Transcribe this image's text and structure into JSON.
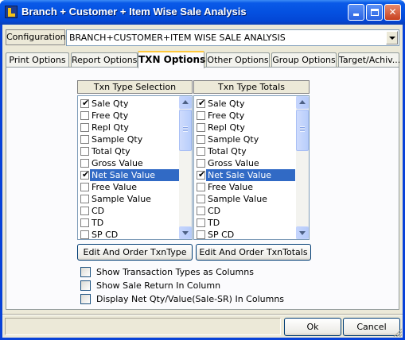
{
  "window": {
    "title": "Branch + Customer + Item Wise Sale Analysis"
  },
  "configuration": {
    "label": "Configuration",
    "value": "BRANCH+CUSTOMER+ITEM WISE SALE ANALYSIS"
  },
  "tabs": [
    {
      "label": "Print Options",
      "active": false
    },
    {
      "label": "Report Options",
      "active": false
    },
    {
      "label": "TXN Options",
      "active": true
    },
    {
      "label": "Other Options",
      "active": false
    },
    {
      "label": "Group Options",
      "active": false
    },
    {
      "label": "Target/Achiv...",
      "active": false
    }
  ],
  "txn_type_selection": {
    "header": "Txn Type Selection",
    "items": [
      {
        "label": "Sale Qty",
        "checked": true,
        "selected": false
      },
      {
        "label": "Free Qty",
        "checked": false,
        "selected": false
      },
      {
        "label": "Repl Qty",
        "checked": false,
        "selected": false
      },
      {
        "label": "Sample Qty",
        "checked": false,
        "selected": false
      },
      {
        "label": "Total Qty",
        "checked": false,
        "selected": false
      },
      {
        "label": "Gross Value",
        "checked": false,
        "selected": false
      },
      {
        "label": "Net Sale Value",
        "checked": true,
        "selected": true
      },
      {
        "label": "Free Value",
        "checked": false,
        "selected": false
      },
      {
        "label": "Sample Value",
        "checked": false,
        "selected": false
      },
      {
        "label": "CD",
        "checked": false,
        "selected": false
      },
      {
        "label": "TD",
        "checked": false,
        "selected": false
      },
      {
        "label": "SP CD",
        "checked": false,
        "selected": false
      }
    ],
    "button_label": "Edit And Order TxnType"
  },
  "txn_type_totals": {
    "header": "Txn Type Totals",
    "items": [
      {
        "label": "Sale Qty",
        "checked": true,
        "selected": false
      },
      {
        "label": "Free Qty",
        "checked": false,
        "selected": false
      },
      {
        "label": "Repl Qty",
        "checked": false,
        "selected": false
      },
      {
        "label": "Sample Qty",
        "checked": false,
        "selected": false
      },
      {
        "label": "Total Qty",
        "checked": false,
        "selected": false
      },
      {
        "label": "Gross Value",
        "checked": false,
        "selected": false
      },
      {
        "label": "Net Sale Value",
        "checked": true,
        "selected": true
      },
      {
        "label": "Free Value",
        "checked": false,
        "selected": false
      },
      {
        "label": "Sample Value",
        "checked": false,
        "selected": false
      },
      {
        "label": "CD",
        "checked": false,
        "selected": false
      },
      {
        "label": "TD",
        "checked": false,
        "selected": false
      },
      {
        "label": "SP CD",
        "checked": false,
        "selected": false
      }
    ],
    "button_label": "Edit And Order TxnTotals"
  },
  "options": [
    {
      "label": "Show Transaction Types as Columns",
      "checked": false
    },
    {
      "label": "Show Sale Return In Column",
      "checked": false
    },
    {
      "label": "Display Net Qty/Value(Sale-SR) In Columns",
      "checked": false
    }
  ],
  "footer": {
    "ok_label": "Ok",
    "cancel_label": "Cancel"
  },
  "icons": {
    "app": "app-logo-icon",
    "minimize": "minimize-icon",
    "maximize": "maximize-icon",
    "close": "close-icon",
    "dropdown": "chevron-down-icon",
    "check": "checkmark-icon"
  },
  "colors": {
    "titlebar": "#0450e0",
    "selection": "#316ac5",
    "dialog_bg": "#ece9d8",
    "active_tab_accent": "#ffc83c"
  }
}
